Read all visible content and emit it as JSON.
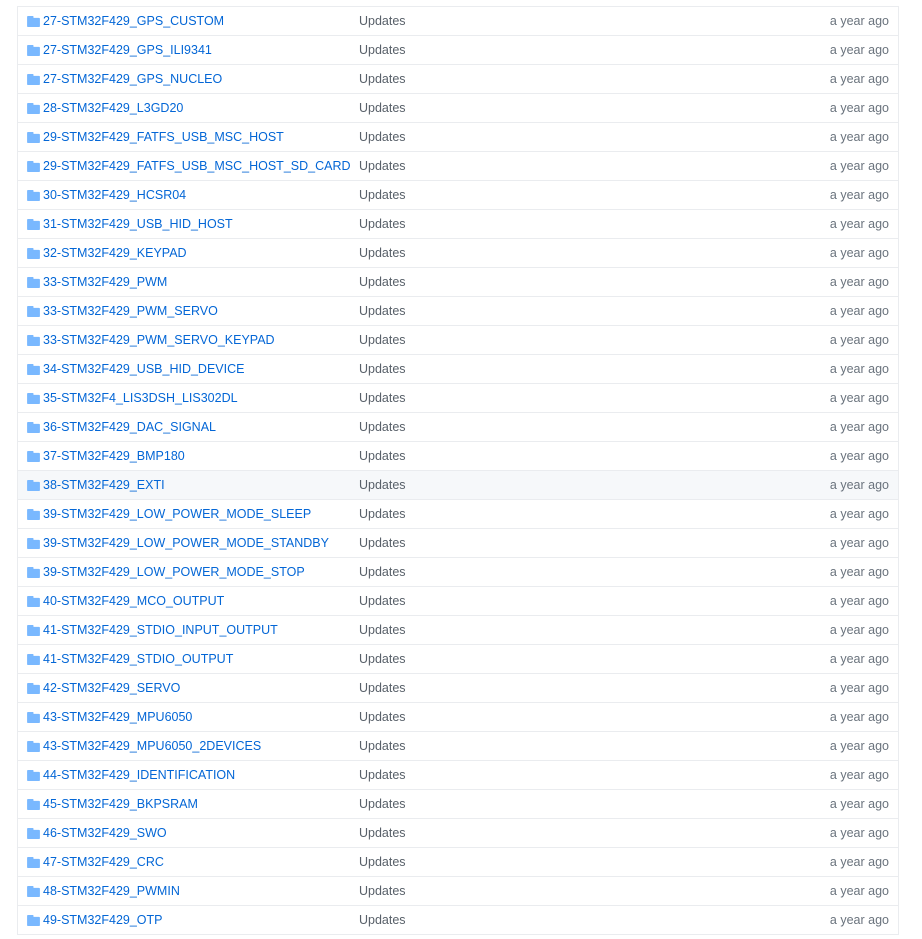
{
  "colors": {
    "link": "#0366d6",
    "folder_icon": "#79b8ff",
    "row_border": "#eaecef",
    "row_hover_bg": "#f6f8fa",
    "muted_text": "#586069"
  },
  "file_list": {
    "rows": [
      {
        "icon": "folder-icon",
        "name": "27-STM32F429_GPS_CUSTOM",
        "message": "Updates",
        "age": "a year ago"
      },
      {
        "icon": "folder-icon",
        "name": "27-STM32F429_GPS_ILI9341",
        "message": "Updates",
        "age": "a year ago"
      },
      {
        "icon": "folder-icon",
        "name": "27-STM32F429_GPS_NUCLEO",
        "message": "Updates",
        "age": "a year ago"
      },
      {
        "icon": "folder-icon",
        "name": "28-STM32F429_L3GD20",
        "message": "Updates",
        "age": "a year ago"
      },
      {
        "icon": "folder-icon",
        "name": "29-STM32F429_FATFS_USB_MSC_HOST",
        "message": "Updates",
        "age": "a year ago"
      },
      {
        "icon": "folder-icon",
        "name": "29-STM32F429_FATFS_USB_MSC_HOST_SD_CARD",
        "message": "Updates",
        "age": "a year ago"
      },
      {
        "icon": "folder-icon",
        "name": "30-STM32F429_HCSR04",
        "message": "Updates",
        "age": "a year ago"
      },
      {
        "icon": "folder-icon",
        "name": "31-STM32F429_USB_HID_HOST",
        "message": "Updates",
        "age": "a year ago"
      },
      {
        "icon": "folder-icon",
        "name": "32-STM32F429_KEYPAD",
        "message": "Updates",
        "age": "a year ago"
      },
      {
        "icon": "folder-icon",
        "name": "33-STM32F429_PWM",
        "message": "Updates",
        "age": "a year ago"
      },
      {
        "icon": "folder-icon",
        "name": "33-STM32F429_PWM_SERVO",
        "message": "Updates",
        "age": "a year ago"
      },
      {
        "icon": "folder-icon",
        "name": "33-STM32F429_PWM_SERVO_KEYPAD",
        "message": "Updates",
        "age": "a year ago"
      },
      {
        "icon": "folder-icon",
        "name": "34-STM32F429_USB_HID_DEVICE",
        "message": "Updates",
        "age": "a year ago"
      },
      {
        "icon": "folder-icon",
        "name": "35-STM32F4_LIS3DSH_LIS302DL",
        "message": "Updates",
        "age": "a year ago"
      },
      {
        "icon": "folder-icon",
        "name": "36-STM32F429_DAC_SIGNAL",
        "message": "Updates",
        "age": "a year ago"
      },
      {
        "icon": "folder-icon",
        "name": "37-STM32F429_BMP180",
        "message": "Updates",
        "age": "a year ago"
      },
      {
        "icon": "folder-icon",
        "name": "38-STM32F429_EXTI",
        "message": "Updates",
        "age": "a year ago",
        "hovered": true
      },
      {
        "icon": "folder-icon",
        "name": "39-STM32F429_LOW_POWER_MODE_SLEEP",
        "message": "Updates",
        "age": "a year ago"
      },
      {
        "icon": "folder-icon",
        "name": "39-STM32F429_LOW_POWER_MODE_STANDBY",
        "message": "Updates",
        "age": "a year ago"
      },
      {
        "icon": "folder-icon",
        "name": "39-STM32F429_LOW_POWER_MODE_STOP",
        "message": "Updates",
        "age": "a year ago"
      },
      {
        "icon": "folder-icon",
        "name": "40-STM32F429_MCO_OUTPUT",
        "message": "Updates",
        "age": "a year ago"
      },
      {
        "icon": "folder-icon",
        "name": "41-STM32F429_STDIO_INPUT_OUTPUT",
        "message": "Updates",
        "age": "a year ago"
      },
      {
        "icon": "folder-icon",
        "name": "41-STM32F429_STDIO_OUTPUT",
        "message": "Updates",
        "age": "a year ago"
      },
      {
        "icon": "folder-icon",
        "name": "42-STM32F429_SERVO",
        "message": "Updates",
        "age": "a year ago"
      },
      {
        "icon": "folder-icon",
        "name": "43-STM32F429_MPU6050",
        "message": "Updates",
        "age": "a year ago"
      },
      {
        "icon": "folder-icon",
        "name": "43-STM32F429_MPU6050_2DEVICES",
        "message": "Updates",
        "age": "a year ago"
      },
      {
        "icon": "folder-icon",
        "name": "44-STM32F429_IDENTIFICATION",
        "message": "Updates",
        "age": "a year ago"
      },
      {
        "icon": "folder-icon",
        "name": "45-STM32F429_BKPSRAM",
        "message": "Updates",
        "age": "a year ago"
      },
      {
        "icon": "folder-icon",
        "name": "46-STM32F429_SWO",
        "message": "Updates",
        "age": "a year ago"
      },
      {
        "icon": "folder-icon",
        "name": "47-STM32F429_CRC",
        "message": "Updates",
        "age": "a year ago"
      },
      {
        "icon": "folder-icon",
        "name": "48-STM32F429_PWMIN",
        "message": "Updates",
        "age": "a year ago"
      },
      {
        "icon": "folder-icon",
        "name": "49-STM32F429_OTP",
        "message": "Updates",
        "age": "a year ago"
      }
    ]
  }
}
